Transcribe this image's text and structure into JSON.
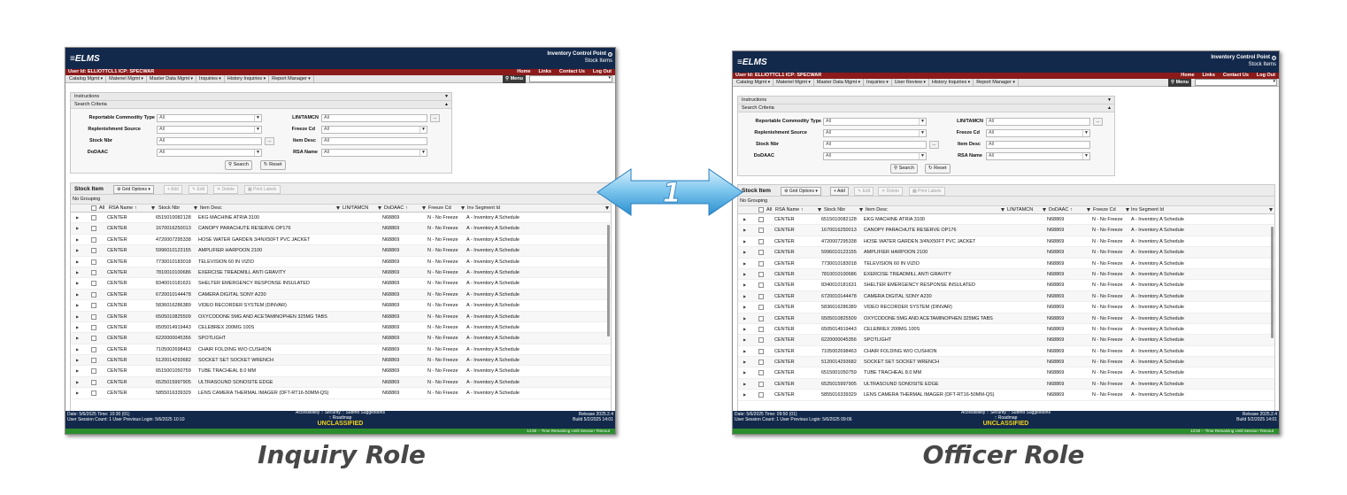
{
  "captions": {
    "left": "Inquiry Role",
    "right": "Officer Role"
  },
  "arrow": {
    "label": "1",
    "color": "#5ab4e8"
  },
  "colors": {
    "header": "#13294b",
    "userbar": "#8b1a1a",
    "unclassified": "#f2d31a",
    "session_bar": "#2c8d2c"
  },
  "app": {
    "logo": "ELMS",
    "title": "Inventory Control Point",
    "subtitle": "Stock Items",
    "user_label": "User Id:  ELLIOTTCL1  ICP:  SPECWAR",
    "links": [
      "Home",
      "Links",
      "Contact Us",
      "Log Out"
    ],
    "menu_button": "Menu",
    "instructions": "Instructions",
    "search_criteria": "Search Criteria",
    "fields": {
      "reportable_commodity_type": {
        "label": "Reportable Commodity Type",
        "value": "All"
      },
      "replenishment_source": {
        "label": "Replenishment Source",
        "value": "All"
      },
      "stock_nbr": {
        "label": "Stock Nbr",
        "value": "All"
      },
      "dodaac": {
        "label": "DoDAAC",
        "value": "All"
      },
      "lin_tamcn": {
        "label": "LIN/TAMCN",
        "value": "All"
      },
      "freeze_cd": {
        "label": "Freeze Cd",
        "value": "All"
      },
      "item_desc": {
        "label": "Item Desc",
        "value": "All"
      },
      "rsa_name": {
        "label": "RSA Name",
        "value": "All"
      }
    },
    "search_button": "Search",
    "reset_button": "Reset",
    "grid": {
      "title": "Stock Item",
      "grid_options": "Grid Options",
      "add": "Add",
      "edit": "Edit",
      "delete": "Delete",
      "print_labels": "Print Labels",
      "grouping": "No Grouping",
      "columns": {
        "all": "All",
        "rsa_name": "RSA Name",
        "stock_nbr": "Stock Nbr",
        "item_desc": "Item Desc",
        "lin_tamcn": "LIN/TAMCN",
        "dodaac": "DoDAAC",
        "freeze_cd": "Freeze Cd",
        "inv_segment": "Inv Segment Id"
      },
      "rows": [
        {
          "rsa": "CENTER",
          "stock": "6515010082128",
          "desc": "EKG MACHINE ATRIA 3100",
          "dodaac": "N68869",
          "freeze": "N - No Freeze",
          "seg": "A - Inventory A Schedule"
        },
        {
          "rsa": "CENTER",
          "stock": "1670016250013",
          "desc": "CANOPY PARACHUTE RESERVE OP176",
          "dodaac": "N68869",
          "freeze": "N - No Freeze",
          "seg": "A - Inventory A Schedule"
        },
        {
          "rsa": "CENTER",
          "stock": "4720007295338",
          "desc": "HOSE WATER GARDEN 3/4NX50FT PVC JACKET",
          "dodaac": "N68869",
          "freeze": "N - No Freeze",
          "seg": "A - Inventory A Schedule"
        },
        {
          "rsa": "CENTER",
          "stock": "5996010123155",
          "desc": "AMPLIFIER HARPOON 2100",
          "dodaac": "N68869",
          "freeze": "N - No Freeze",
          "seg": "A - Inventory A Schedule"
        },
        {
          "rsa": "CENTER",
          "stock": "7730010183018",
          "desc": "TELEVISION 60 IN VIZIO",
          "dodaac": "N68869",
          "freeze": "N - No Freeze",
          "seg": "A - Inventory A Schedule"
        },
        {
          "rsa": "CENTER",
          "stock": "7810010100686",
          "desc": "EXERCISE TREADMILL ANTI GRAVITY",
          "dodaac": "N68869",
          "freeze": "N - No Freeze",
          "seg": "A - Inventory A Schedule"
        },
        {
          "rsa": "CENTER",
          "stock": "8340010181631",
          "desc": "SHELTER EMERGENCY RESPONSE INSULATED",
          "dodaac": "N68869",
          "freeze": "N - No Freeze",
          "seg": "A - Inventory A Schedule"
        },
        {
          "rsa": "CENTER",
          "stock": "6720010144478",
          "desc": "CAMERA DIGITAL SONY A230",
          "dodaac": "N68869",
          "freeze": "N - No Freeze",
          "seg": "A - Inventory A Schedule"
        },
        {
          "rsa": "CENTER",
          "stock": "5836016286389",
          "desc": "VIDEO RECORDER SYSTEM (DINVAR)",
          "dodaac": "N68869",
          "freeze": "N - No Freeze",
          "seg": "A - Inventory A Schedule"
        },
        {
          "rsa": "CENTER",
          "stock": "6505010825509",
          "desc": "OXYCODONE 5MG AND ACETAMINOPHEN 325MG TABS",
          "dodaac": "N68869",
          "freeze": "N - No Freeze",
          "seg": "A - Inventory A Schedule"
        },
        {
          "rsa": "CENTER",
          "stock": "6505014919443",
          "desc": "CELEBREX 200MG 100S",
          "dodaac": "N68869",
          "freeze": "N - No Freeze",
          "seg": "A - Inventory A Schedule"
        },
        {
          "rsa": "CENTER",
          "stock": "6220000045356",
          "desc": "SPOTLIGHT",
          "dodaac": "N68869",
          "freeze": "N - No Freeze",
          "seg": "A - Inventory A Schedule"
        },
        {
          "rsa": "CENTER",
          "stock": "7105002698463",
          "desc": "CHAIR FOLDING W/O CUSHION",
          "dodaac": "N68869",
          "freeze": "N - No Freeze",
          "seg": "A - Inventory A Schedule"
        },
        {
          "rsa": "CENTER",
          "stock": "5120014293682",
          "desc": "SOCKET SET SOCKET WRENCH",
          "dodaac": "N68869",
          "freeze": "N - No Freeze",
          "seg": "A - Inventory A Schedule"
        },
        {
          "rsa": "CENTER",
          "stock": "6515001050759",
          "desc": "TUBE TRACHEAL 8.0 MM",
          "dodaac": "N68869",
          "freeze": "N - No Freeze",
          "seg": "A - Inventory A Schedule"
        },
        {
          "rsa": "CENTER",
          "stock": "6525015997905",
          "desc": "ULTRASOUND SONOSITE EDGE",
          "dodaac": "N68869",
          "freeze": "N - No Freeze",
          "seg": "A - Inventory A Schedule"
        },
        {
          "rsa": "CENTER",
          "stock": "5855016339329",
          "desc": "LENS CAMERA THERMAL IMAGER (DFT-RT16-50MM-QS)",
          "dodaac": "N68869",
          "freeze": "N - No Freeze",
          "seg": "A - Inventory A Schedule"
        }
      ]
    },
    "footer": {
      "accessibility": "Accessibility",
      "security": "Security",
      "submit": "Submit Suggestions",
      "roadmap": "Roadmap",
      "unclassified": "UNCLASSIFIED",
      "session_count": "User Session Count: 1   User Previous Login: 5/6/2025 10:10"
    }
  },
  "left": {
    "menus": [
      "Catalog Mgmt",
      "Materiel Mgmt",
      "Master Data Mgmt",
      "Inquiries",
      "History Inquiries",
      "Report Manager"
    ],
    "date_time": "Date: 5/6/2025  Time: 10:30 (01)",
    "session_count": "User Session Count: 1   User Previous Login: 5/6/2025 10:10",
    "release": "Release 2025.2.4",
    "build": "Build 5/2/2025 14:01",
    "timer": "14:50 -- Time Remaining Until Session Timeout"
  },
  "right": {
    "menus": [
      "Catalog Mgmt",
      "Materiel Mgmt",
      "Master Data Mgmt",
      "Inquiries",
      "User Review",
      "History Inquiries",
      "Report Manager"
    ],
    "date_time": "Date: 5/6/2025  Time: 09:50 (01)",
    "session_count": "User Session Count: 1   User Previous Login: 5/6/2025 09:06",
    "release": "Release 2025.2.4",
    "build": "Build 5/2/2025 14:01",
    "timer": "13:50 -- Time Remaining Until Session Timeout"
  }
}
